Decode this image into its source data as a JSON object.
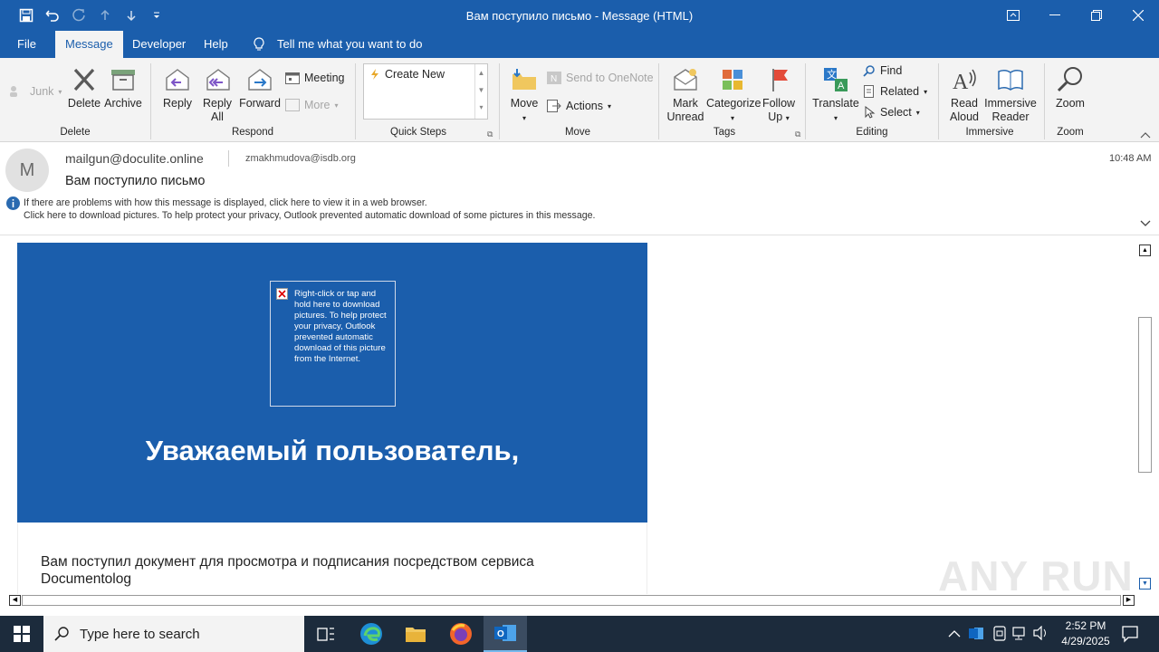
{
  "window": {
    "title": "Вам поступило письмо  -  Message (HTML)"
  },
  "tabs": [
    {
      "label": "File"
    },
    {
      "label": "Message"
    },
    {
      "label": "Developer"
    },
    {
      "label": "Help"
    }
  ],
  "tell_me": "Tell me what you want to do",
  "ribbon": {
    "junk": "Junk",
    "delete": "Delete",
    "archive": "Archive",
    "reply": "Reply",
    "reply_all_1": "Reply",
    "reply_all_2": "All",
    "forward": "Forward",
    "meeting": "Meeting",
    "more": "More",
    "create_new": "Create New",
    "move": "Move",
    "send_onenote": "Send to OneNote",
    "actions": "Actions",
    "mark_unread_1": "Mark",
    "mark_unread_2": "Unread",
    "categorize": "Categorize",
    "follow_up_1": "Follow",
    "follow_up_2": "Up",
    "translate": "Translate",
    "find": "Find",
    "related": "Related",
    "select": "Select",
    "read_aloud_1": "Read",
    "read_aloud_2": "Aloud",
    "immersive_1": "Immersive",
    "immersive_2": "Reader",
    "zoom": "Zoom",
    "groups": {
      "delete": "Delete",
      "respond": "Respond",
      "quick_steps": "Quick Steps",
      "move": "Move",
      "tags": "Tags",
      "editing": "Editing",
      "immersive": "Immersive",
      "zoom": "Zoom"
    }
  },
  "message": {
    "avatar_letter": "M",
    "from": "mailgun@doculite.online",
    "to": "zmakhmudova@isdb.org",
    "time": "10:48 AM",
    "subject": "Вам поступило письмо",
    "info_line_1": "If there are problems with how this message is displayed, click here to view it in a web browser.",
    "info_line_2": "Click here to download pictures. To help protect your privacy, Outlook prevented automatic download of some pictures in this message.",
    "image_placeholder": "Right-click or tap and hold here to download pictures. To help protect your privacy, Outlook prevented automatic download of this picture from the Internet.",
    "greeting": "Уважаемый пользователь,",
    "body_text": "Вам поступил документ для просмотра и подписания посредством сервиса Documentolog"
  },
  "taskbar": {
    "search_placeholder": "Type here to search",
    "time": "2:52 PM",
    "date": "4/29/2025"
  },
  "watermark": "ANY RUN",
  "colors": {
    "accent": "#1b5eac",
    "taskbar": "#1c2b3c",
    "ribbon": "#f3f3f3"
  }
}
